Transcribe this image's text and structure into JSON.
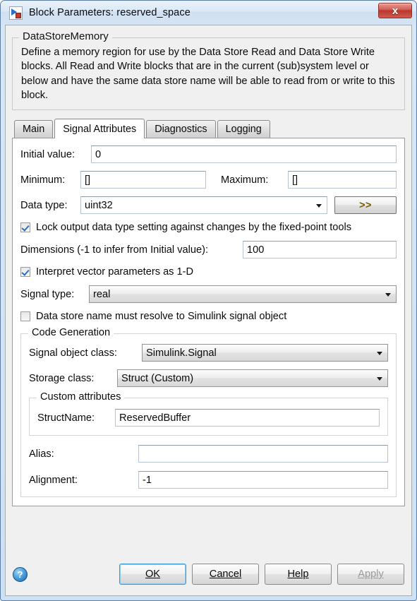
{
  "window": {
    "title": "Block Parameters: reserved_space",
    "icon": "simulink-block-icon",
    "close_label": "x"
  },
  "description": {
    "legend": "DataStoreMemory",
    "text": "Define a memory region for use by the Data Store Read and Data Store Write blocks. All Read and Write blocks that are in the current (sub)system level or below and have the same data store name will be able to read from or write to this block."
  },
  "tabs": [
    {
      "label": "Main",
      "active": false
    },
    {
      "label": "Signal Attributes",
      "active": true
    },
    {
      "label": "Diagnostics",
      "active": false
    },
    {
      "label": "Logging",
      "active": false
    }
  ],
  "form": {
    "initial_value": {
      "label": "Initial value:",
      "value": "0"
    },
    "minimum": {
      "label": "Minimum:",
      "value": "[]"
    },
    "maximum": {
      "label": "Maximum:",
      "value": "[]"
    },
    "data_type": {
      "label": "Data type:",
      "value": "uint32",
      "more_button": ">>"
    },
    "lock_output": {
      "label": "Lock output data type setting against changes by the fixed-point tools",
      "checked": true
    },
    "dimensions": {
      "label": "Dimensions (-1 to infer from Initial value):",
      "value": "100"
    },
    "interpret_vector": {
      "label": "Interpret vector parameters as 1-D",
      "checked": true
    },
    "signal_type": {
      "label": "Signal type:",
      "value": "real"
    },
    "must_resolve": {
      "label": "Data store name must resolve to Simulink signal object",
      "checked": false
    }
  },
  "code_generation": {
    "legend": "Code Generation",
    "signal_object_class": {
      "label": "Signal object class:",
      "value": "Simulink.Signal"
    },
    "storage_class": {
      "label": "Storage class:",
      "value": "Struct (Custom)"
    },
    "custom_attributes": {
      "legend": "Custom attributes",
      "struct_name": {
        "label": "StructName:",
        "value": "ReservedBuffer"
      }
    },
    "alias": {
      "label": "Alias:",
      "value": ""
    },
    "alignment": {
      "label": "Alignment:",
      "value": "-1"
    }
  },
  "buttons": {
    "help_icon": "?",
    "ok": "OK",
    "cancel": "Cancel",
    "help": "Help",
    "apply": "Apply"
  },
  "colors": {
    "accent_blue": "#2a6fc6",
    "close_red": "#b9362c",
    "more_button_text": "#7a5a00",
    "dialog_bg": "#f0f0f0",
    "panel_bg": "#ffffff"
  }
}
